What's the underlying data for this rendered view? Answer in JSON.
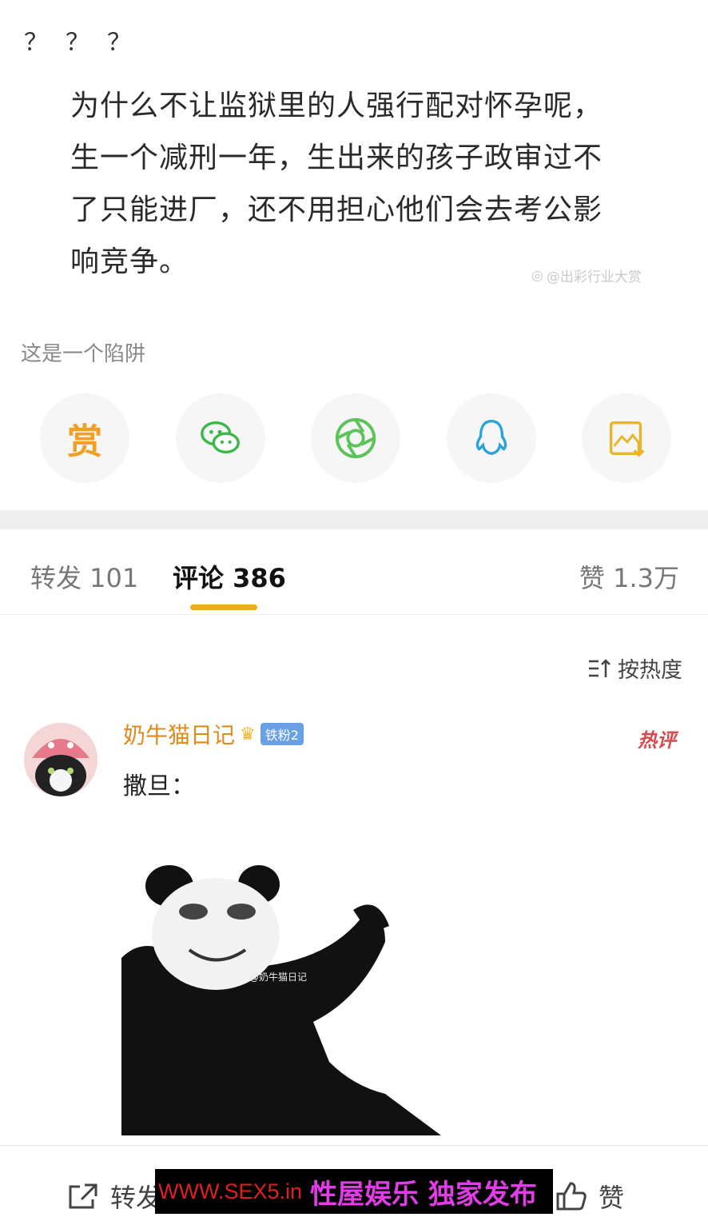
{
  "post": {
    "question_marks": "？？？",
    "lines": [
      "为什么不让监狱里的人强行配对怀孕呢，",
      "生一个减刑一年，生出来的孩子政审过不",
      "了只能进厂，还不用担心他们会去考公影",
      "响竞争。"
    ],
    "watermark": "@出彩行业大赏",
    "caption": "这是一个陷阱"
  },
  "share": {
    "reward_label": "赏",
    "icons": [
      "reward-icon",
      "wechat-icon",
      "moments-icon",
      "qq-icon",
      "save-image-icon"
    ],
    "colors": {
      "reward": "#f0a023",
      "wechat": "#3cb84a",
      "moments": "#5cc25a",
      "qq": "#2aa3d6",
      "save": "#e8b52a"
    }
  },
  "tabs": {
    "repost": "转发 101",
    "comments": "评论 386",
    "likes": "赞 1.3万",
    "accent": "#f2a91d"
  },
  "sort": {
    "label": "按热度"
  },
  "comment": {
    "username": "奶牛猫日记",
    "fan_badge": "铁粉2",
    "hot_tag": "热评",
    "text": "撒旦：",
    "image_watermark": "@奶牛猫日记"
  },
  "bottom": {
    "repost": "转发",
    "like": "赞"
  },
  "promo": {
    "url": "WWW.SEX5.in",
    "text": "性屋娱乐 独家发布"
  }
}
